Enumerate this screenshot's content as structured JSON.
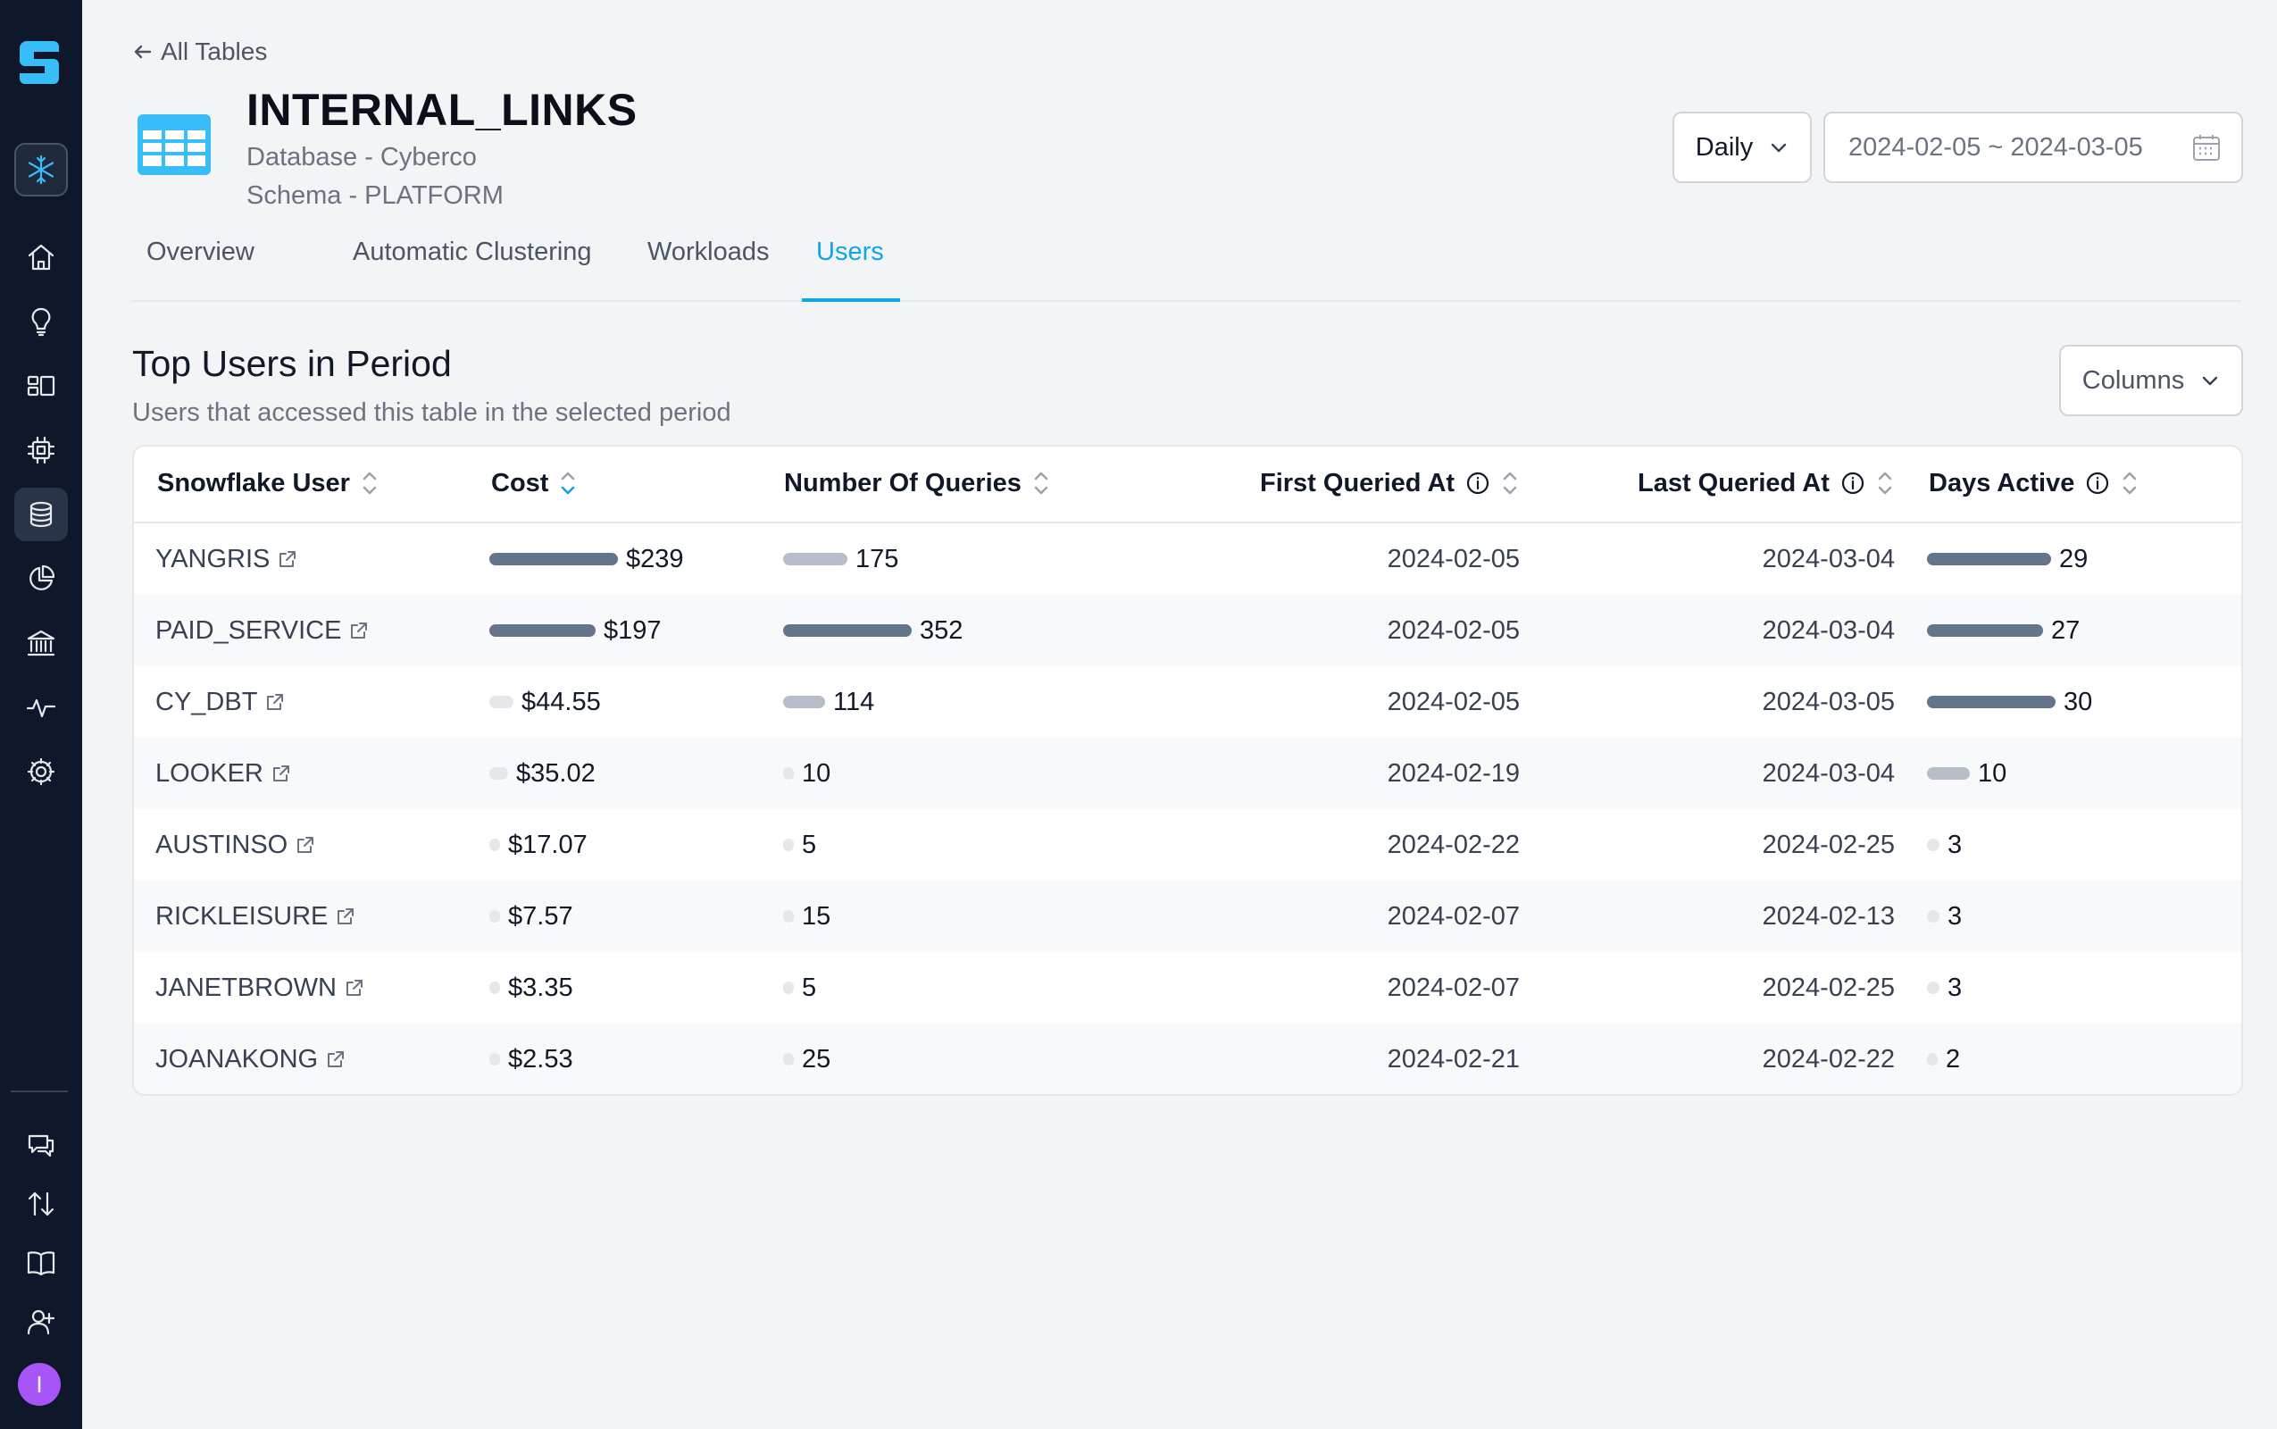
{
  "breadcrumb": {
    "back_label": "All Tables"
  },
  "header": {
    "title": "INTERNAL_LINKS",
    "database": "Database - Cyberco",
    "schema": "Schema - PLATFORM"
  },
  "controls": {
    "period": "Daily",
    "date_range": "2024-02-05 ~ 2024-03-05"
  },
  "tabs": [
    {
      "label": "Overview",
      "active": false
    },
    {
      "label": "Automatic Clustering",
      "active": false
    },
    {
      "label": "Workloads",
      "active": false
    },
    {
      "label": "Users",
      "active": true
    }
  ],
  "section": {
    "title": "Top Users in Period",
    "subtitle": "Users that accessed this table in the selected period",
    "columns_button": "Columns"
  },
  "table": {
    "headers": {
      "user": "Snowflake User",
      "cost": "Cost",
      "queries": "Number Of Queries",
      "first": "First Queried At",
      "last": "Last Queried At",
      "days": "Days Active"
    },
    "rows": [
      {
        "user": "YANGRIS",
        "cost": "$239",
        "cost_value": 239,
        "queries": "175",
        "queries_value": 175,
        "first": "2024-02-05",
        "last": "2024-03-04",
        "days": "29",
        "days_value": 29
      },
      {
        "user": "PAID_SERVICE",
        "cost": "$197",
        "cost_value": 197,
        "queries": "352",
        "queries_value": 352,
        "first": "2024-02-05",
        "last": "2024-03-04",
        "days": "27",
        "days_value": 27
      },
      {
        "user": "CY_DBT",
        "cost": "$44.55",
        "cost_value": 44.55,
        "queries": "114",
        "queries_value": 114,
        "first": "2024-02-05",
        "last": "2024-03-05",
        "days": "30",
        "days_value": 30
      },
      {
        "user": "LOOKER",
        "cost": "$35.02",
        "cost_value": 35.02,
        "queries": "10",
        "queries_value": 10,
        "first": "2024-02-19",
        "last": "2024-03-04",
        "days": "10",
        "days_value": 10
      },
      {
        "user": "AUSTINSO",
        "cost": "$17.07",
        "cost_value": 17.07,
        "queries": "5",
        "queries_value": 5,
        "first": "2024-02-22",
        "last": "2024-02-25",
        "days": "3",
        "days_value": 3
      },
      {
        "user": "RICKLEISURE",
        "cost": "$7.57",
        "cost_value": 7.57,
        "queries": "15",
        "queries_value": 15,
        "first": "2024-02-07",
        "last": "2024-02-13",
        "days": "3",
        "days_value": 3
      },
      {
        "user": "JANETBROWN",
        "cost": "$3.35",
        "cost_value": 3.35,
        "queries": "5",
        "queries_value": 5,
        "first": "2024-02-07",
        "last": "2024-02-25",
        "days": "3",
        "days_value": 3
      },
      {
        "user": "JOANAKONG",
        "cost": "$2.53",
        "cost_value": 2.53,
        "queries": "25",
        "queries_value": 25,
        "first": "2024-02-21",
        "last": "2024-02-22",
        "days": "2",
        "days_value": 2
      }
    ]
  },
  "sidebar": {
    "items": [
      "home-icon",
      "lightbulb-icon",
      "dashboard-icon",
      "chip-icon",
      "database-icon",
      "pie-chart-icon",
      "bank-icon",
      "activity-icon",
      "gear-icon",
      "chat-icon",
      "transfer-icon",
      "book-icon",
      "add-user-icon"
    ],
    "avatar_initial": "I"
  },
  "colors": {
    "accent": "#0ea5e9",
    "bar_strong": "#64748b",
    "bar_medium": "#b8bec9",
    "bar_light": "#e5e7eb",
    "sidebar_bg": "#0f172a"
  }
}
